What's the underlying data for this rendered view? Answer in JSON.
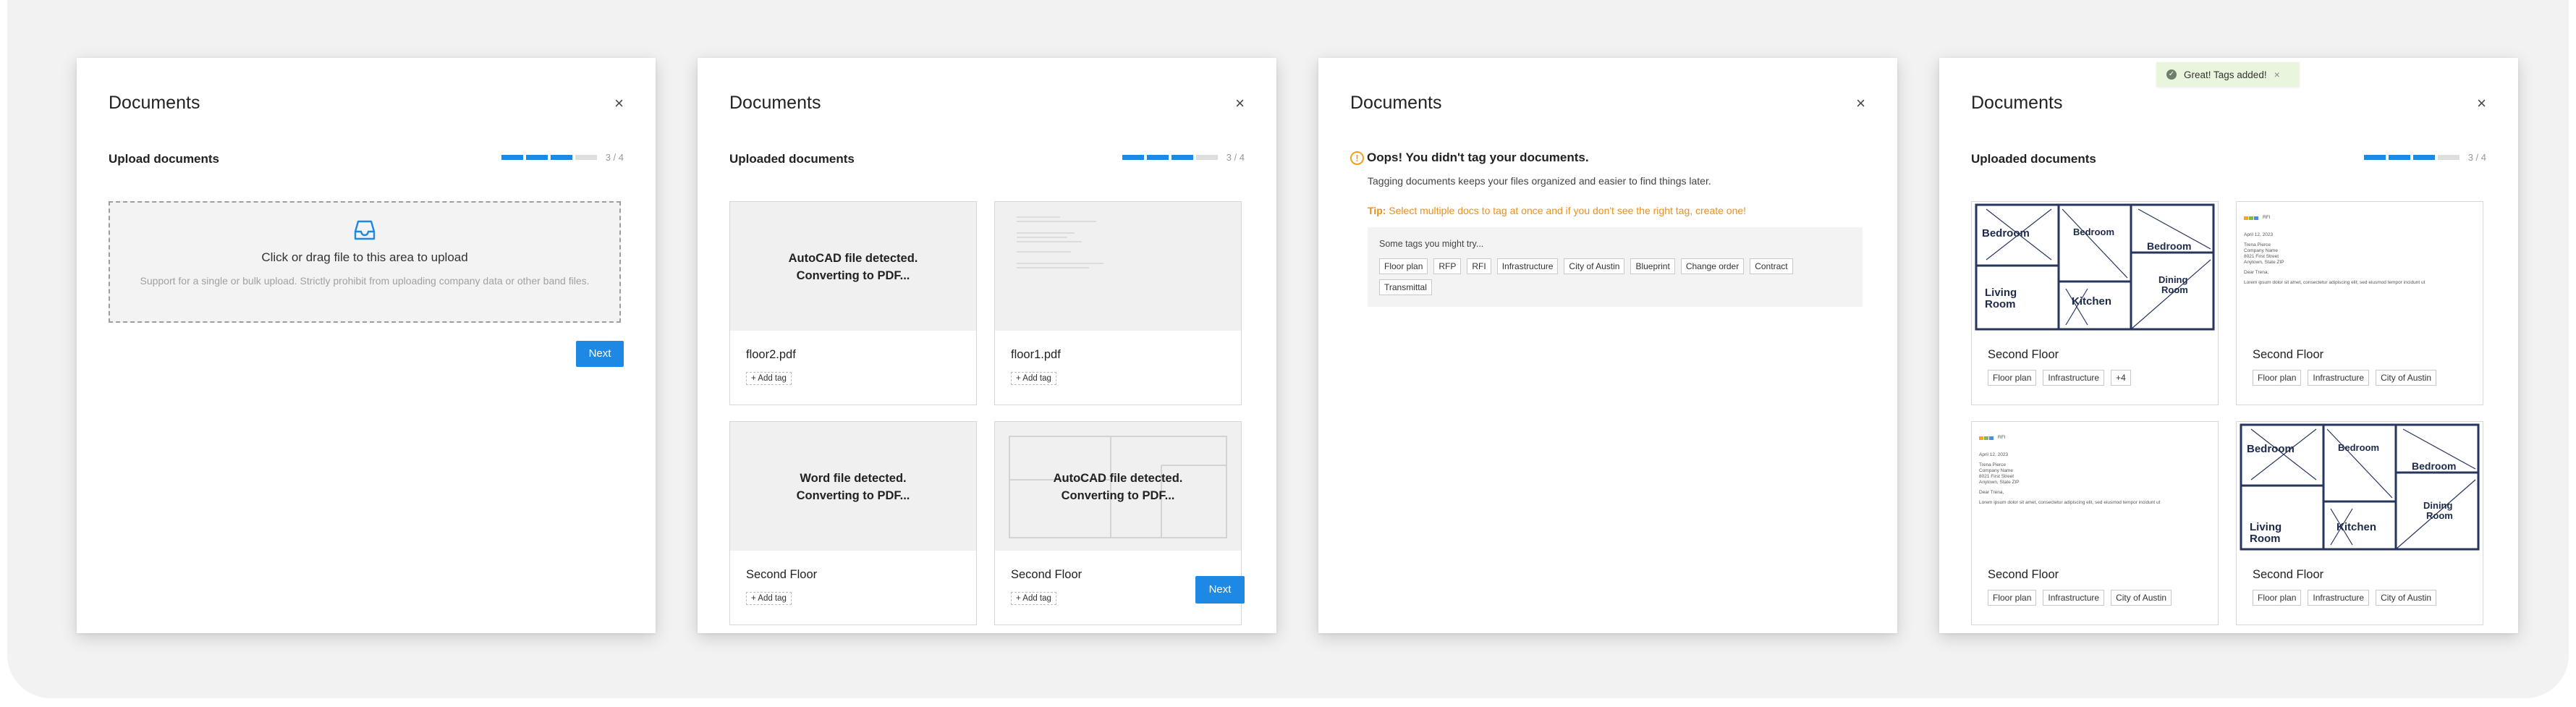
{
  "panels": {
    "p1": {
      "title": "Documents",
      "close": "×",
      "subtitle": "Upload documents",
      "progress": {
        "current": 3,
        "total": 4,
        "text": "3 / 4"
      },
      "dropzone": {
        "icon": "inbox-icon",
        "main": "Click or drag file to this area to upload",
        "hint": "Support for a single or bulk upload. Strictly prohibit from uploading company data or other band files."
      },
      "next": "Next"
    },
    "p2": {
      "title": "Documents",
      "close": "×",
      "subtitle": "Uploaded documents",
      "progress": {
        "current": 3,
        "total": 4,
        "text": "3 / 4"
      },
      "cards": [
        {
          "status_line1": "AutoCAD file detected.",
          "status_line2": "Converting to PDF...",
          "name": "floor2.pdf",
          "add_tag": "+ Add tag"
        },
        {
          "status_line1": "",
          "status_line2": "",
          "name": "floor1.pdf",
          "add_tag": "+ Add tag"
        },
        {
          "status_line1": "Word file detected.",
          "status_line2": "Converting to PDF...",
          "name": "Second Floor",
          "add_tag": "+ Add tag"
        },
        {
          "status_line1": "AutoCAD file detected.",
          "status_line2": "Converting to PDF...",
          "name": "Second Floor",
          "add_tag": "+ Add tag"
        }
      ],
      "next": "Next"
    },
    "p3": {
      "title": "Documents",
      "close": "×",
      "warning_title": "Oops! You didn't tag your documents.",
      "warning_body": "Tagging documents keeps your files organized and easier to find things later.",
      "tip_label": "Tip:",
      "tip_text": " Select multiple docs to tag at once and if you don't see the right tag, create one!",
      "suggest_title": "Some tags you might try...",
      "suggested_tags": [
        "Floor plan",
        "RFP",
        "RFI",
        "Infrastructure",
        "City of Austin",
        "Blueprint",
        "Change order",
        "Contract",
        "Transmittal"
      ]
    },
    "p4": {
      "title": "Documents",
      "close": "×",
      "subtitle": "Uploaded documents",
      "progress": {
        "current": 3,
        "total": 4,
        "text": "3 / 4"
      },
      "toast": {
        "text": "Great! Tags added!",
        "close": "×"
      },
      "blueprint_labels": {
        "bedroom": "Bedroom",
        "living": "Living",
        "room": "Room",
        "kitchen": "Kitchen",
        "dining": "Dining"
      },
      "cards": [
        {
          "name": "Second Floor",
          "tags": [
            "Floor plan",
            "Infrastructure",
            "+4"
          ]
        },
        {
          "name": "Second Floor",
          "tags": [
            "Floor plan",
            "Infrastructure",
            "City of Austin"
          ]
        },
        {
          "name": "Second Floor",
          "tags": [
            "Floor plan",
            "Infrastructure",
            "City of Austin"
          ]
        },
        {
          "name": "Second Floor",
          "tags": [
            "Floor plan",
            "Infrastructure",
            "City of Austin"
          ]
        }
      ],
      "rfi_doc": {
        "label": "RFI",
        "date": "April 12, 2023",
        "address": [
          "Trena Pierce",
          "Company Name",
          "8021 First Street",
          "Anytown, State ZIP"
        ],
        "greeting": "Dear Trena,",
        "body": "Lorem ipsum dolor sit amet, consectetur adipiscing elit, sed eiusmod tempor incidunt ut"
      }
    }
  }
}
